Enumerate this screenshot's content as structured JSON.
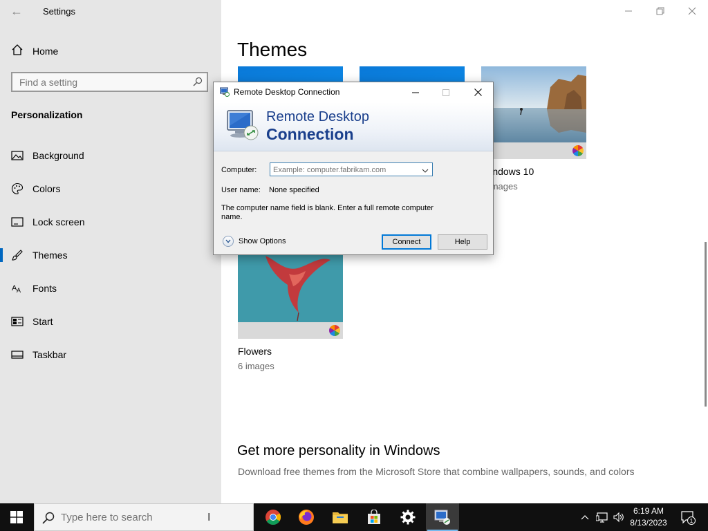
{
  "settings": {
    "app_title": "Settings",
    "home_label": "Home",
    "search_placeholder": "Find a setting",
    "section_title": "Personalization",
    "nav_items": [
      {
        "label": "Background",
        "icon": "picture-icon"
      },
      {
        "label": "Colors",
        "icon": "palette-icon"
      },
      {
        "label": "Lock screen",
        "icon": "lock-screen-icon"
      },
      {
        "label": "Themes",
        "icon": "brush-icon",
        "active": true
      },
      {
        "label": "Fonts",
        "icon": "font-icon"
      },
      {
        "label": "Start",
        "icon": "start-icon"
      },
      {
        "label": "Taskbar",
        "icon": "taskbar-icon"
      }
    ]
  },
  "themes": {
    "page_title": "Themes",
    "cards": [
      {
        "name": "Windows 10",
        "count": "5 images"
      },
      {
        "name": "Flowers",
        "count": "6 images"
      }
    ],
    "more_title": "Get more personality in Windows",
    "more_desc": "Download free themes from the Microsoft Store that combine wallpapers, sounds, and colors"
  },
  "rdc": {
    "title": "Remote Desktop Connection",
    "banner_line1": "Remote Desktop",
    "banner_line2": "Connection",
    "computer_label": "Computer:",
    "computer_placeholder": "Example: computer.fabrikam.com",
    "username_label": "User name:",
    "username_value": "None specified",
    "message": "The computer name field is blank. Enter a full remote computer name.",
    "show_options": "Show Options",
    "connect": "Connect",
    "help": "Help"
  },
  "taskbar": {
    "search_placeholder": "Type here to search",
    "time": "6:19 AM",
    "date": "8/13/2023",
    "notification_count": "1",
    "apps": [
      "chrome-icon",
      "firefox-icon",
      "file-explorer-icon",
      "microsoft-store-icon",
      "settings-gear-icon",
      "remote-desktop-icon"
    ]
  },
  "colors": {
    "accent": "#0067c0",
    "sidebar_bg": "#e6e6e6",
    "taskbar_bg": "#101010",
    "rdc_banner_text": "#1a3f8c"
  }
}
